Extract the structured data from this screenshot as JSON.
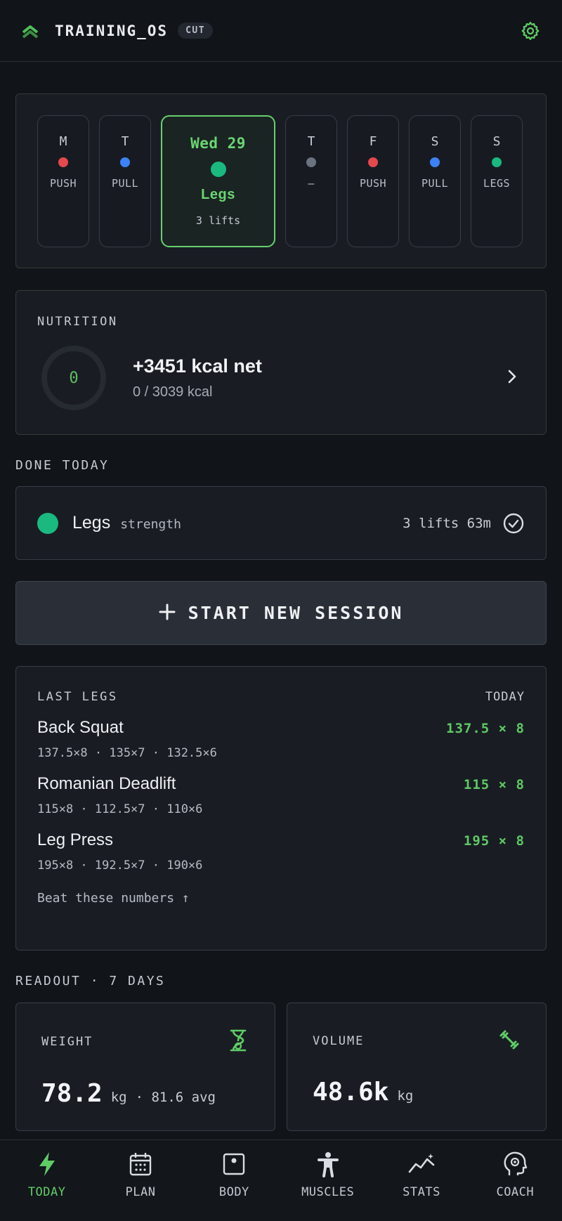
{
  "header": {
    "title": "TRAINING_OS",
    "phase_badge": "CUT",
    "logo_icon": "double-chevron-up-icon",
    "settings_icon": "gear-icon"
  },
  "colors": {
    "accent": "#62cc67",
    "push": "#e5484d",
    "pull": "#3b82f6",
    "legs": "#19b980",
    "rest": "#6b7280"
  },
  "week": {
    "days": [
      {
        "letter": "M",
        "type": "PUSH",
        "dot": "push"
      },
      {
        "letter": "T",
        "type": "PULL",
        "dot": "pull"
      },
      {
        "letter": "Wed 29",
        "type": "Legs",
        "sub": "3 lifts",
        "dot": "legs",
        "active": true
      },
      {
        "letter": "T",
        "type": "–",
        "dot": "rest"
      },
      {
        "letter": "F",
        "type": "PUSH",
        "dot": "push"
      },
      {
        "letter": "S",
        "type": "PULL",
        "dot": "pull"
      },
      {
        "letter": "S",
        "type": "LEGS",
        "dot": "legs"
      }
    ]
  },
  "nutrition": {
    "label": "NUTRITION",
    "ring_value": "0",
    "net": "+3451 kcal net",
    "intake": "0 / 3039 kcal"
  },
  "done_today": {
    "label": "DONE TODAY",
    "name": "Legs",
    "kind": "strength",
    "meta": "3 lifts 63m"
  },
  "start": {
    "label": "START NEW SESSION"
  },
  "last_session": {
    "label": "LAST LEGS",
    "when": "TODAY",
    "lifts": [
      {
        "name": "Back Squat",
        "best": "137.5 × 8",
        "sets": "137.5×8 · 135×7 · 132.5×6"
      },
      {
        "name": "Romanian Deadlift",
        "best": "115 × 8",
        "sets": "115×8 · 112.5×7 · 110×6"
      },
      {
        "name": "Leg Press",
        "best": "195 × 8",
        "sets": "195×8 · 192.5×7 · 190×6"
      }
    ],
    "footer": "Beat these numbers ↑"
  },
  "readout": {
    "label": "READOUT · 7 DAYS",
    "weight": {
      "label": "WEIGHT",
      "value": "78.2",
      "unit": "kg",
      "avg": "· 81.6 avg"
    },
    "volume": {
      "label": "VOLUME",
      "value": "48.6k",
      "unit": "kg"
    }
  },
  "nav": [
    {
      "label": "TODAY",
      "icon": "bolt-icon",
      "active": true
    },
    {
      "label": "PLAN",
      "icon": "calendar-icon"
    },
    {
      "label": "BODY",
      "icon": "scale-icon"
    },
    {
      "label": "MUSCLES",
      "icon": "person-icon"
    },
    {
      "label": "STATS",
      "icon": "trend-icon"
    },
    {
      "label": "COACH",
      "icon": "head-gear-icon"
    }
  ]
}
